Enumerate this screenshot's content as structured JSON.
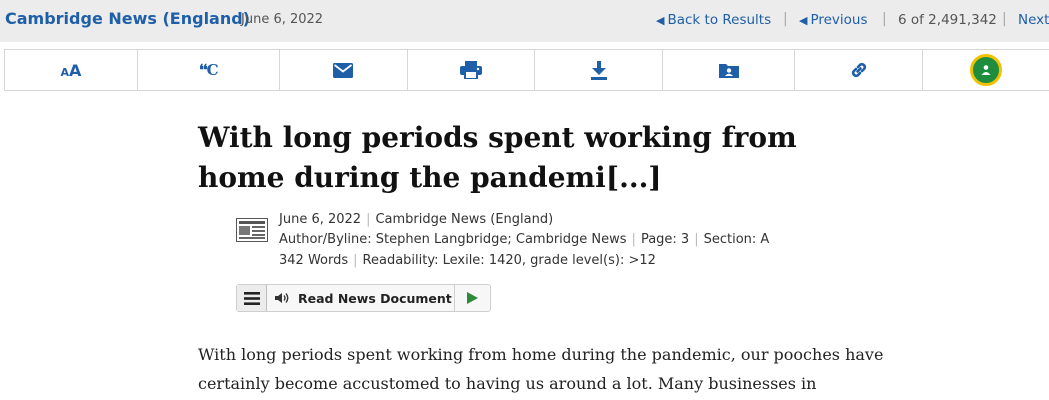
{
  "header": {
    "source": "Cambridge News (England)",
    "date": "June 6, 2022",
    "back_label": "Back to Results",
    "previous_label": "Previous",
    "position": "6 of 2,491,342",
    "next_label": "Next",
    "separator": "|"
  },
  "toolbar": {
    "items": [
      {
        "icon": "font-size-icon"
      },
      {
        "icon": "cite-icon",
        "text": "❛❛C"
      },
      {
        "icon": "email-icon"
      },
      {
        "icon": "print-icon"
      },
      {
        "icon": "download-icon"
      },
      {
        "icon": "save-folder-icon"
      },
      {
        "icon": "link-icon"
      },
      {
        "icon": "google-classroom-icon"
      }
    ],
    "accent_color": "#1f5fa8"
  },
  "article": {
    "title": "With long periods spent working from home during the pandemi[...]",
    "date": "June 6, 2022",
    "source": "Cambridge News (England)",
    "byline": "Author/Byline: Stephen Langbridge; Cambridge News",
    "page": "Page: 3",
    "section": "Section: A",
    "words": "342 Words",
    "readability": "Readability: Lexile: 1420, grade level(s): >12",
    "reader_label": "Read News Document",
    "body": "With long periods spent working from home during the pandemic, our pooches have certainly become accustomed to having us around a lot. Many businesses in"
  }
}
